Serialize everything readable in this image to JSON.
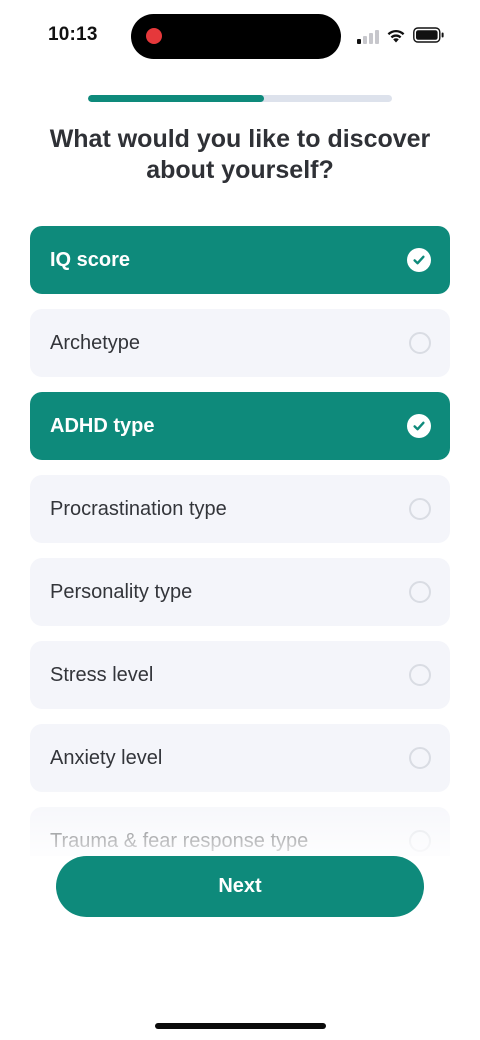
{
  "status_bar": {
    "time": "10:13",
    "recording_indicator_color": "#e5383b",
    "icons": [
      "signal-icon",
      "wifi-icon",
      "battery-icon"
    ]
  },
  "progress": {
    "fraction": 0.58,
    "fill_color": "#0e8a7b",
    "track_color": "#dde2ec"
  },
  "title": "What would you like to discover about yourself?",
  "options": [
    {
      "label": "IQ score",
      "selected": true,
      "icon": "check-icon"
    },
    {
      "label": "Archetype",
      "selected": false,
      "icon": "radio-icon"
    },
    {
      "label": "ADHD type",
      "selected": true,
      "icon": "check-icon"
    },
    {
      "label": "Procrastination type",
      "selected": false,
      "icon": "radio-icon"
    },
    {
      "label": "Personality type",
      "selected": false,
      "icon": "radio-icon"
    },
    {
      "label": "Stress level",
      "selected": false,
      "icon": "radio-icon"
    },
    {
      "label": "Anxiety level",
      "selected": false,
      "icon": "radio-icon"
    },
    {
      "label": "Trauma & fear response type",
      "selected": false,
      "icon": "radio-icon"
    }
  ],
  "next_button": {
    "label": "Next"
  },
  "colors": {
    "accent": "#0e8a7b",
    "option_background": "#f4f5fa",
    "text": "#33353a"
  }
}
